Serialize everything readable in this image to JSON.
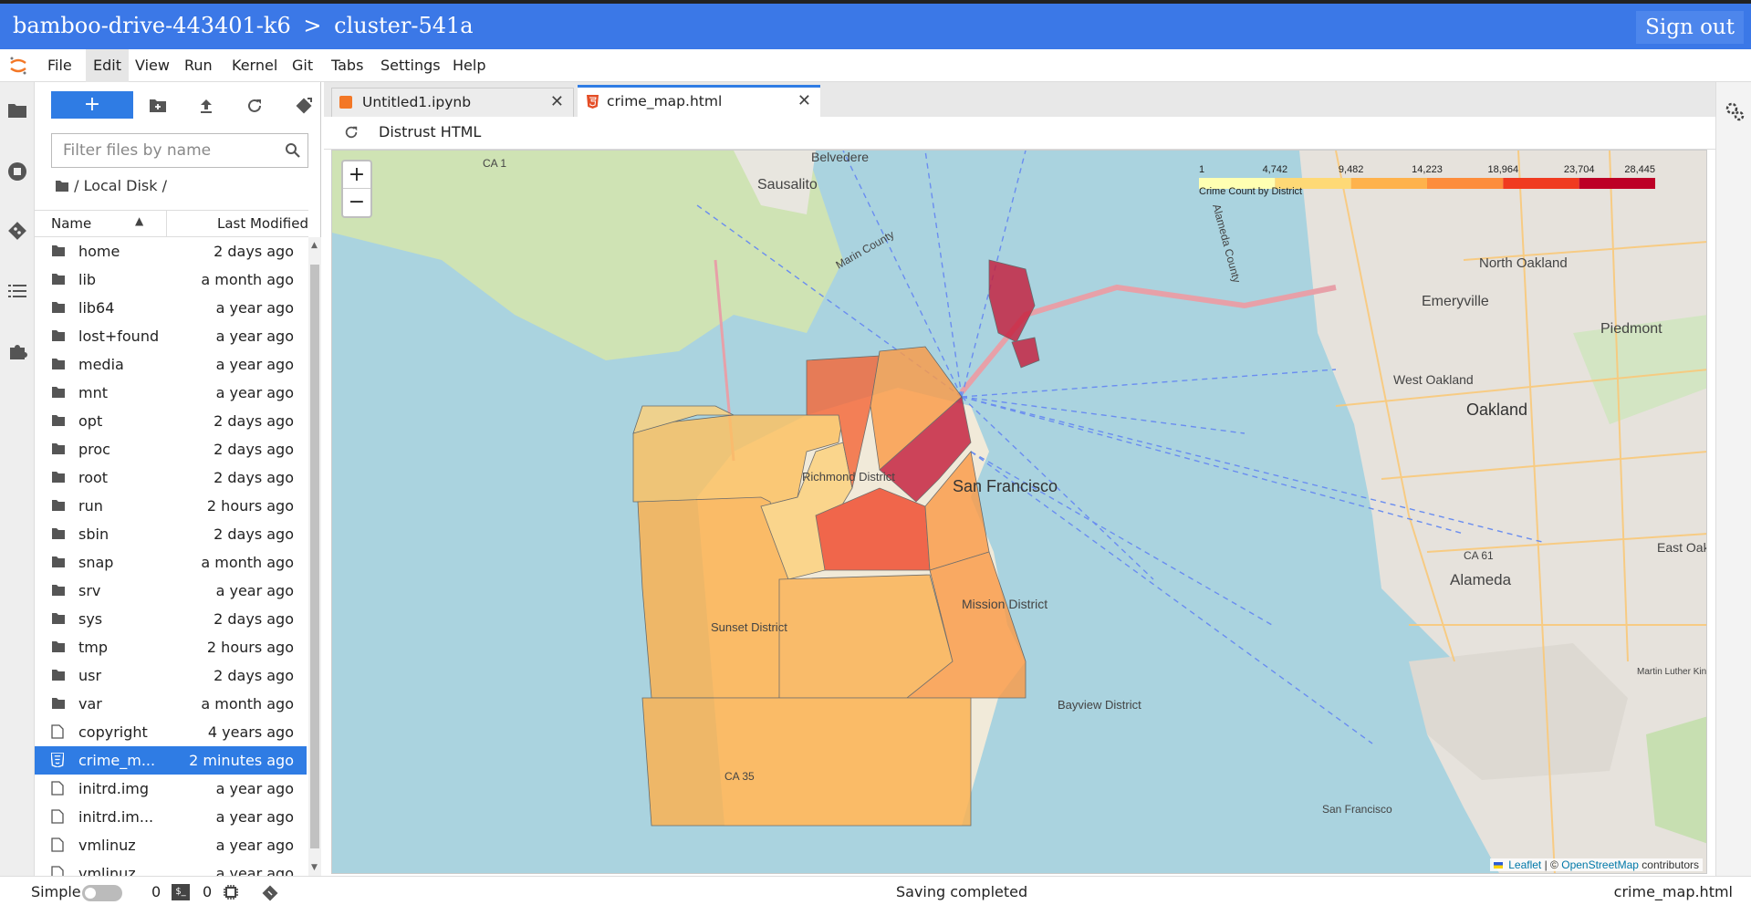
{
  "header": {
    "project": "bamboo-drive-443401-k6",
    "separator": ">",
    "cluster": "cluster-541a",
    "signout_label": "Sign out"
  },
  "menu": [
    "File",
    "Edit",
    "View",
    "Run",
    "Kernel",
    "Git",
    "Tabs",
    "Settings",
    "Help"
  ],
  "filebrowser": {
    "new_label": "+",
    "filter_placeholder": "Filter files by name",
    "breadcrumb": "/ Local Disk /",
    "col_name": "Name",
    "col_modified": "Last Modified",
    "files": [
      {
        "name": "home",
        "modified": "2 days ago",
        "type": "folder"
      },
      {
        "name": "lib",
        "modified": "a month ago",
        "type": "folder"
      },
      {
        "name": "lib64",
        "modified": "a year ago",
        "type": "folder"
      },
      {
        "name": "lost+found",
        "modified": "a year ago",
        "type": "folder"
      },
      {
        "name": "media",
        "modified": "a year ago",
        "type": "folder"
      },
      {
        "name": "mnt",
        "modified": "a year ago",
        "type": "folder"
      },
      {
        "name": "opt",
        "modified": "2 days ago",
        "type": "folder"
      },
      {
        "name": "proc",
        "modified": "2 days ago",
        "type": "folder"
      },
      {
        "name": "root",
        "modified": "2 days ago",
        "type": "folder"
      },
      {
        "name": "run",
        "modified": "2 hours ago",
        "type": "folder"
      },
      {
        "name": "sbin",
        "modified": "2 days ago",
        "type": "folder"
      },
      {
        "name": "snap",
        "modified": "a month ago",
        "type": "folder"
      },
      {
        "name": "srv",
        "modified": "a year ago",
        "type": "folder"
      },
      {
        "name": "sys",
        "modified": "2 days ago",
        "type": "folder"
      },
      {
        "name": "tmp",
        "modified": "2 hours ago",
        "type": "folder"
      },
      {
        "name": "usr",
        "modified": "2 days ago",
        "type": "folder"
      },
      {
        "name": "var",
        "modified": "a month ago",
        "type": "folder"
      },
      {
        "name": "copyright",
        "modified": "4 years ago",
        "type": "file"
      },
      {
        "name": "crime_m...",
        "modified": "2 minutes ago",
        "type": "html",
        "selected": true
      },
      {
        "name": "initrd.img",
        "modified": "a year ago",
        "type": "file"
      },
      {
        "name": "initrd.im...",
        "modified": "a year ago",
        "type": "file"
      },
      {
        "name": "vmlinuz",
        "modified": "a year ago",
        "type": "file"
      },
      {
        "name": "vmlinuz....",
        "modified": "a year ago",
        "type": "file"
      }
    ]
  },
  "tabs": [
    {
      "label": "Untitled1.ipynb",
      "active": false
    },
    {
      "label": "crime_map.html",
      "active": true
    }
  ],
  "toolbar": {
    "distrust_label": "Distrust HTML"
  },
  "map": {
    "legend_ticks": [
      "1",
      "4,742",
      "9,482",
      "14,223",
      "18,964",
      "23,704",
      "28,445"
    ],
    "legend_caption": "Crime Count by District",
    "legend_colors": [
      "#ffffb2",
      "#fed976",
      "#feb24c",
      "#fd8d3c",
      "#f03b20",
      "#bd0026"
    ],
    "zoom_in": "+",
    "zoom_out": "−",
    "labels": {
      "belvedere": "Belvedere",
      "sausalito": "Sausalito",
      "north_oakland": "North Oakland",
      "emeryville": "Emeryville",
      "piedmont": "Piedmont",
      "west_oakland": "West Oakland",
      "oakland": "Oakland",
      "alameda": "Alameda",
      "east_oak": "East Oak",
      "richmond": "Richmond District",
      "sf": "San Francisco",
      "mission": "Mission District",
      "sunset": "Sunset District",
      "bayview": "Bayview District",
      "ca61": "CA 61",
      "ca1": "CA 1",
      "ca35": "CA 35",
      "marin": "Marin County",
      "alameda_county": "Alameda County",
      "sf_road1": "San Francisco",
      "sf_road2": "San Francisco",
      "sf_bottom": "San Francisco",
      "mlk": "Martin Luther King Jr Regional Shoreline"
    },
    "attribution_leaflet": "Leaflet",
    "attribution_sep": " | © ",
    "attribution_osm": "OpenStreetMap",
    "attribution_tail": " contributors"
  },
  "statusbar": {
    "mode_label": "Simple",
    "kernels_count": "0",
    "terminals_count": "0",
    "message": "Saving completed",
    "current_file": "crime_map.html"
  }
}
